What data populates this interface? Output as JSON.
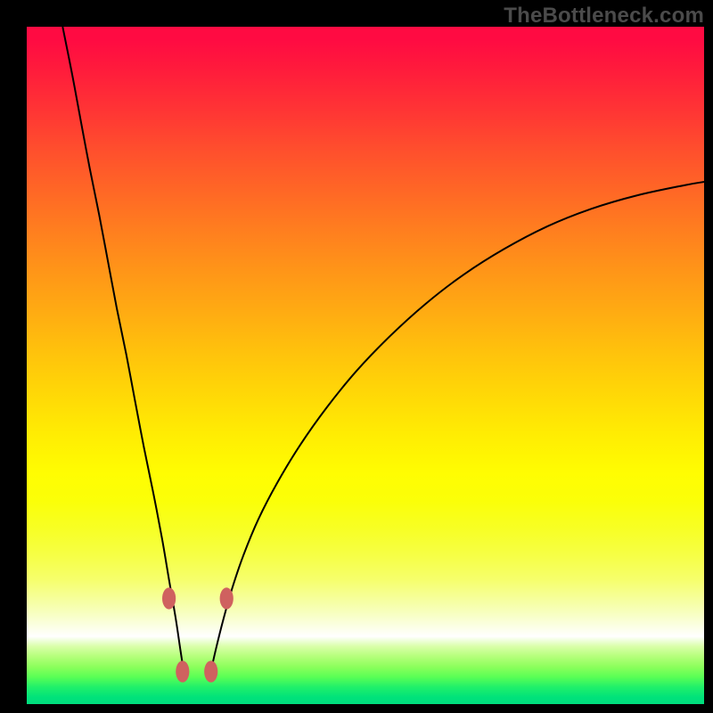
{
  "watermark": "TheBottleneck.com",
  "colors": {
    "marker": "#cf615f",
    "curve": "#000000"
  },
  "chart_data": {
    "type": "line",
    "title": "",
    "xlabel": "",
    "ylabel": "",
    "xlim": [
      0,
      100
    ],
    "ylim": [
      0,
      100
    ],
    "grid": false,
    "description": "Two branches of a bottleneck curve over a vertical red-to-green gradient background. Values are in percent of plot dimensions (0=left/bottom, 100=right/top).",
    "series": [
      {
        "name": "left-branch",
        "x": [
          5.3,
          6.7,
          8.0,
          9.3,
          10.7,
          12.0,
          13.3,
          14.7,
          16.0,
          17.3,
          18.7,
          20.0,
          21.0,
          22.0,
          22.7,
          23.3
        ],
        "y": [
          100.0,
          93.0,
          86.0,
          79.1,
          72.2,
          65.3,
          58.4,
          51.6,
          44.7,
          37.9,
          31.1,
          24.3,
          18.4,
          12.6,
          7.9,
          4.0
        ]
      },
      {
        "name": "right-branch",
        "x": [
          27.0,
          27.9,
          29.0,
          30.3,
          32.0,
          34.2,
          37.0,
          40.4,
          44.3,
          48.7,
          53.6,
          58.9,
          64.5,
          70.5,
          76.8,
          83.3,
          90.1,
          97.1,
          100.0
        ],
        "y": [
          4.0,
          8.0,
          12.4,
          17.0,
          22.0,
          27.3,
          32.7,
          38.3,
          43.8,
          49.2,
          54.3,
          59.1,
          63.4,
          67.2,
          70.5,
          73.1,
          75.1,
          76.6,
          77.1
        ]
      }
    ],
    "markers": [
      {
        "series": "left-branch",
        "x": 21.0,
        "y": 15.6,
        "rx": 1.0,
        "ry": 1.6
      },
      {
        "series": "left-branch",
        "x": 23.0,
        "y": 4.8,
        "rx": 1.0,
        "ry": 1.6
      },
      {
        "series": "right-branch",
        "x": 27.2,
        "y": 4.8,
        "rx": 1.0,
        "ry": 1.6
      },
      {
        "series": "right-branch",
        "x": 29.5,
        "y": 15.6,
        "rx": 1.0,
        "ry": 1.6
      }
    ]
  }
}
